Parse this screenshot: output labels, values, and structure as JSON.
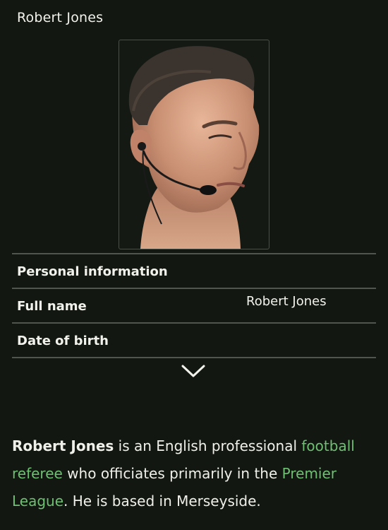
{
  "infobox": {
    "title": "Robert Jones",
    "image": {
      "alt_subject": "referee-portrait"
    },
    "section_header": "Personal information",
    "rows": [
      {
        "label": "Full name",
        "value": "Robert Jones"
      },
      {
        "label": "Date of birth",
        "value": ""
      }
    ],
    "expand_icon": "chevron-down-icon"
  },
  "summary": {
    "subject": "Robert Jones",
    "text_1": " is an English professional ",
    "link_football": "football referee",
    "text_2": " who officiates primarily in the ",
    "link_league": "Premier League",
    "text_3": ". He is based in Merseyside."
  },
  "colors": {
    "background": "#121811",
    "link": "#6fbf73",
    "divider": "#50554e",
    "text": "#f0f0ea"
  }
}
